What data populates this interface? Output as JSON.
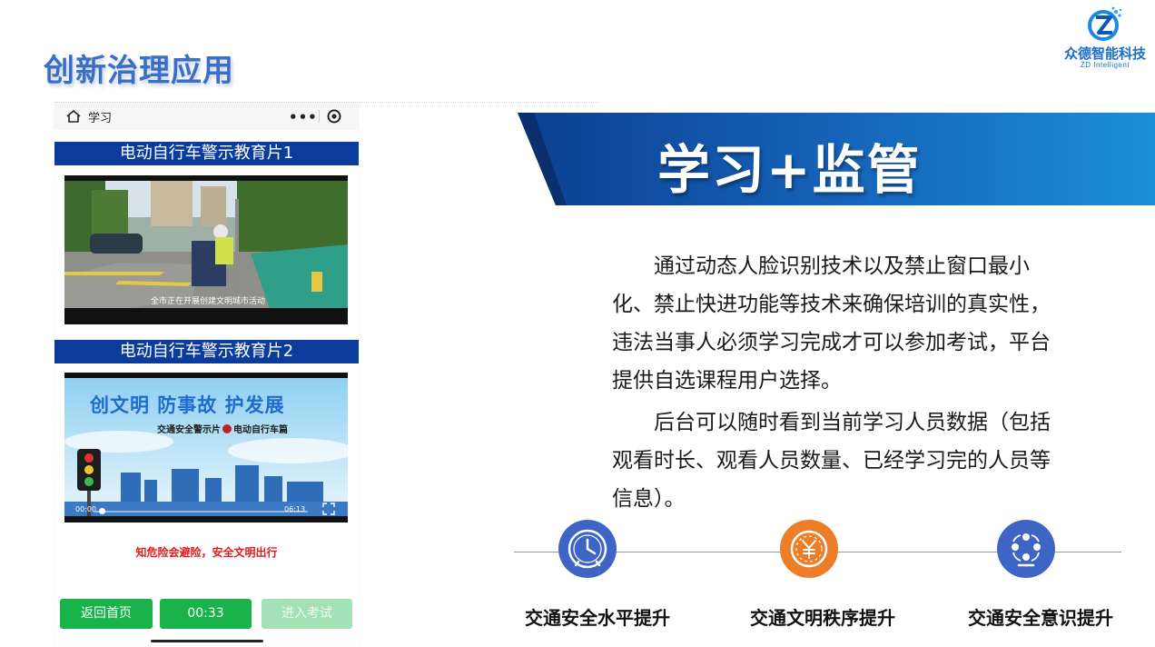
{
  "slide": {
    "title": "创新治理应用"
  },
  "logo": {
    "name": "众德智能科技",
    "subtitle": "ZD Intelligent",
    "mark": "Z"
  },
  "phone": {
    "page_title": "学习",
    "header_icons": [
      "home-icon",
      "more-icon",
      "target-icon"
    ],
    "more_glyph": "•••",
    "videos": [
      {
        "banner": "电动自行车警示教育片1",
        "caption": "全市正在开展创建文明城市活动"
      },
      {
        "banner": "电动自行车警示教育片2",
        "poster_title": "创文明  防事故  护发展",
        "poster_sub_left": "交通安全警示片",
        "poster_sub_right": "电动自行车篇",
        "time_current": "00:00",
        "time_total": "06:13",
        "progress": 0.02
      }
    ],
    "warning": "知危险会避险，安全文明出行",
    "buttons": {
      "home": "返回首页",
      "timer": "00:33",
      "exam": "进入考试"
    }
  },
  "main": {
    "banner_title": "学习+监管",
    "paragraph_1": "通过动态人脸识别技术以及禁止窗口最小化、禁止快进功能等技术来确保培训的真实性，违法当事人必须学习完成才可以参加考试，平台提供自选课程用户选择。",
    "paragraph_2": "后台可以随时看到当前学习人员数据（包括观看时长、观看人员数量、已经学习完的人员等信息）。",
    "benefits": [
      {
        "label": "交通安全水平提升",
        "icon": "clock-icon",
        "color": "#3e64c6"
      },
      {
        "label": "交通文明秩序提升",
        "icon": "yen-coin-icon",
        "color": "#ee7d27"
      },
      {
        "label": "交通安全意识提升",
        "icon": "people-network-icon",
        "color": "#3e64c6"
      }
    ]
  },
  "colors": {
    "title_blue": "#3a6fc4",
    "banner_navy": "#0b3c9c",
    "button_green": "#18b34a",
    "warning_red": "#e0191f"
  }
}
